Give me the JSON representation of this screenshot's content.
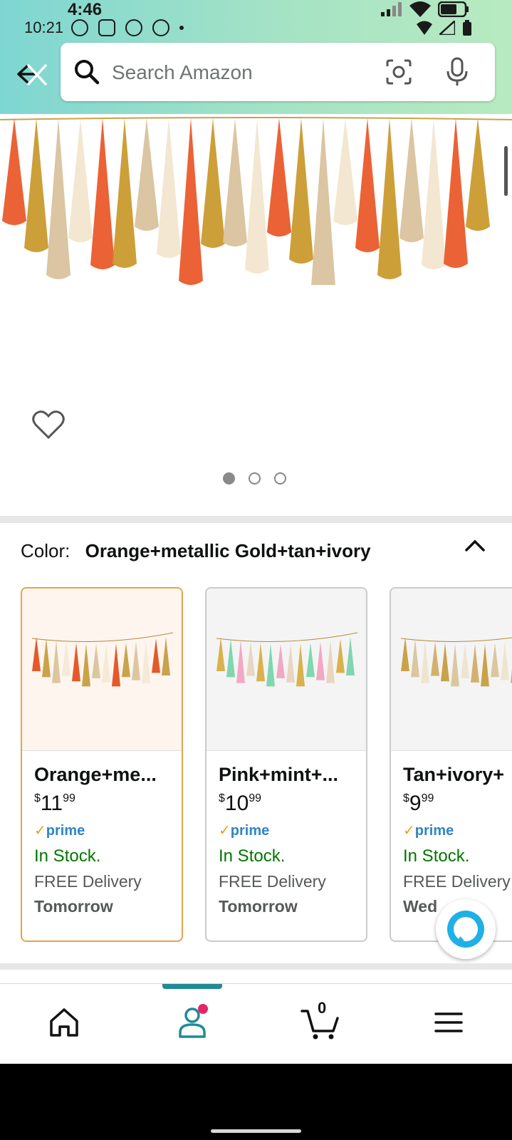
{
  "status_bar": {
    "time_top": "4:46",
    "time": "10:21"
  },
  "search": {
    "placeholder": "Search Amazon"
  },
  "product": {
    "carousel_total": 3,
    "carousel_active": 1
  },
  "color_section": {
    "label": "Color:",
    "value": "Orange+metallic Gold+tan+ivory"
  },
  "swatches": [
    {
      "name": "Orange+me...",
      "price_whole": "11",
      "price_cents": "99",
      "prime": "prime",
      "stock": "In Stock.",
      "delivery": "FREE Delivery",
      "when": "Tomorrow",
      "selected": true
    },
    {
      "name": "Pink+mint+...",
      "price_whole": "10",
      "price_cents": "99",
      "prime": "prime",
      "stock": "In Stock.",
      "delivery": "FREE Delivery",
      "when": "Tomorrow",
      "selected": false
    },
    {
      "name": "Tan+ivory+",
      "price_whole": "9",
      "price_cents": "99",
      "prime": "prime",
      "stock": "In Stock.",
      "delivery": "FREE Delivery",
      "when": "Wed",
      "selected": false
    }
  ],
  "bottom_nav": {
    "cart_count": "0"
  },
  "colors": {
    "accent_teal": "#1f8b97",
    "in_stock": "#007600",
    "prime_blue": "#2f86c2",
    "selected_border": "#e2a54c"
  }
}
